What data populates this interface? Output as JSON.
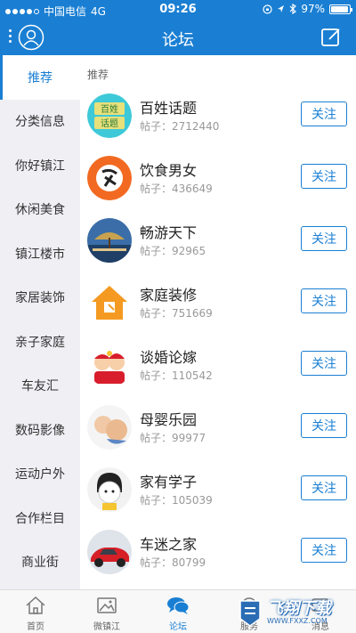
{
  "status": {
    "carrier": "中国电信",
    "network": "4G",
    "time": "09:26",
    "battery": "97%",
    "battery_level": 0.97
  },
  "header": {
    "title": "论坛"
  },
  "sidebar": {
    "items": [
      {
        "label": "推荐",
        "active": true
      },
      {
        "label": "分类信息"
      },
      {
        "label": "你好镇江"
      },
      {
        "label": "休闲美食"
      },
      {
        "label": "镇江楼市"
      },
      {
        "label": "家居装饰"
      },
      {
        "label": "亲子家庭"
      },
      {
        "label": "车友汇"
      },
      {
        "label": "数码影像"
      },
      {
        "label": "运动户外"
      },
      {
        "label": "合作栏目"
      },
      {
        "label": "商业街"
      }
    ]
  },
  "content": {
    "section_label": "推荐",
    "forums": [
      {
        "name": "百姓话题",
        "posts": "帖子：2712440",
        "follow": "关注",
        "icon": "baixing-topic-icon"
      },
      {
        "name": "饮食男女",
        "posts": "帖子：436649",
        "follow": "关注",
        "icon": "food-icon"
      },
      {
        "name": "畅游天下",
        "posts": "帖子：92965",
        "follow": "关注",
        "icon": "travel-icon"
      },
      {
        "name": "家庭装修",
        "posts": "帖子：751669",
        "follow": "关注",
        "icon": "house-renovation-icon"
      },
      {
        "name": "谈婚论嫁",
        "posts": "帖子：110542",
        "follow": "关注",
        "icon": "wedding-icon"
      },
      {
        "name": "母婴乐园",
        "posts": "帖子：99977",
        "follow": "关注",
        "icon": "mother-baby-icon"
      },
      {
        "name": "家有学子",
        "posts": "帖子：105039",
        "follow": "关注",
        "icon": "student-icon"
      },
      {
        "name": "车迷之家",
        "posts": "帖子：80799",
        "follow": "关注",
        "icon": "car-icon"
      }
    ]
  },
  "tabbar": {
    "tabs": [
      {
        "label": "首页",
        "icon": "home-icon"
      },
      {
        "label": "微镇江",
        "icon": "image-icon"
      },
      {
        "label": "论坛",
        "icon": "chat-bubbles-icon",
        "active": true
      },
      {
        "label": "服务",
        "icon": "service-icon"
      },
      {
        "label": "消息",
        "icon": "message-icon"
      }
    ]
  },
  "watermark": {
    "text": "飞翔下载",
    "url": "WWW.FXXZ.COM"
  },
  "colors": {
    "primary": "#1a7fd3",
    "sidebar_bg": "#efeff4"
  }
}
